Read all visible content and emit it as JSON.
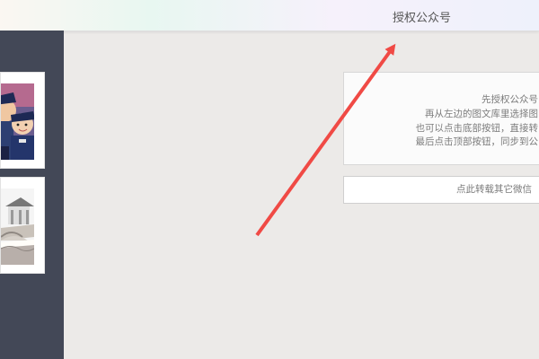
{
  "header": {
    "authorize_label": "授权公众号"
  },
  "sidebar": {
    "thumbnails": [
      {
        "icon": "police-cartoon-image"
      },
      {
        "icon": "pavilion-bridge-image"
      }
    ]
  },
  "tip": {
    "lines": [
      "先授权公众号",
      "再从左边的图文库里选择图",
      "也可以点击底部按钮，直接转",
      "最后点击顶部按钮，同步到公"
    ]
  },
  "repost": {
    "label": "点此转载其它微信"
  },
  "annotation": {
    "arrow_color": "#f04a45"
  }
}
